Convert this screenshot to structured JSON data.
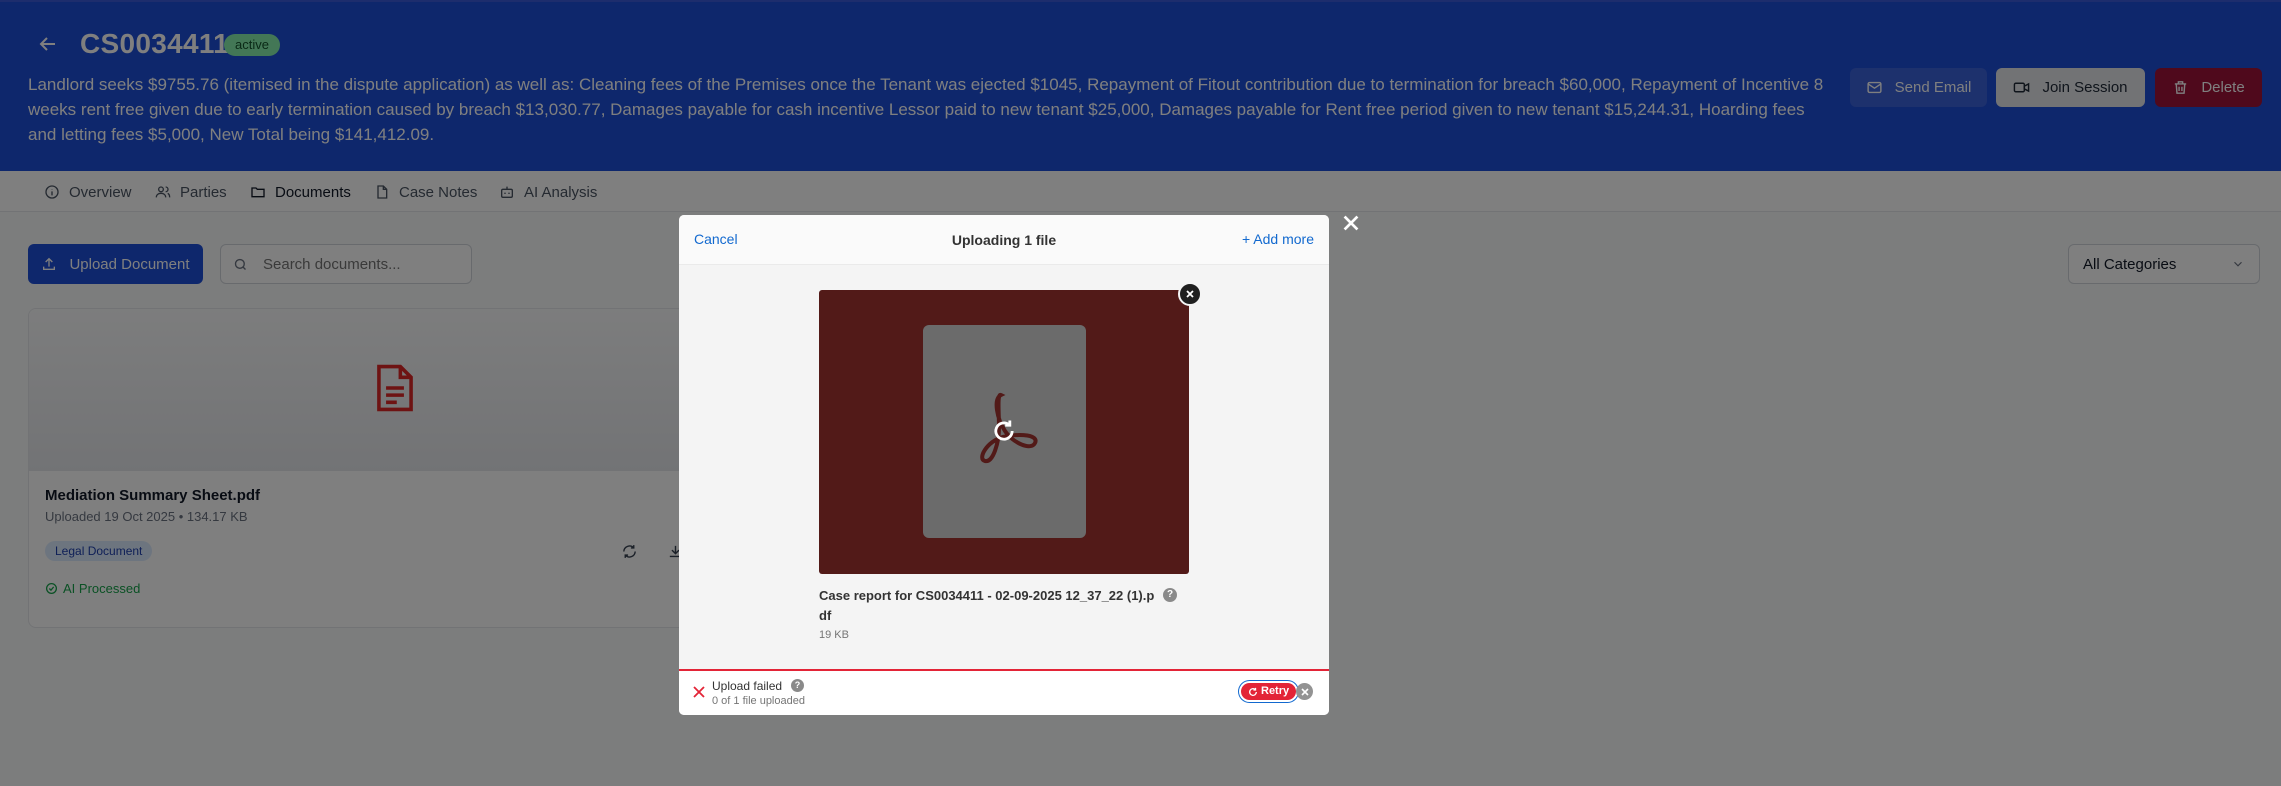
{
  "case": {
    "id": "CS0034411",
    "status": "active",
    "description": "Landlord seeks $9755.76 (itemised in the dispute application) as well as: Cleaning fees of the Premises once the Tenant was ejected $1045, Repayment of Fitout contribution due to termination for breach $60,000, Repayment of Incentive 8 weeks rent free given due to early termination caused by breach $13,030.77, Damages payable for cash incentive Lessor paid to new tenant $25,000, Damages payable for Rent free period given to new tenant $15,244.31, Hoarding fees and letting fees $5,000, New Total being $141,412.09."
  },
  "header_actions": {
    "send_email": "Send Email",
    "join_session": "Join Session",
    "delete": "Delete"
  },
  "tabs": [
    {
      "label": "Overview",
      "icon": "info-icon"
    },
    {
      "label": "Parties",
      "icon": "users-icon"
    },
    {
      "label": "Documents",
      "icon": "folder-icon"
    },
    {
      "label": "Case Notes",
      "icon": "file-icon"
    },
    {
      "label": "AI Analysis",
      "icon": "robot-icon"
    }
  ],
  "toolbar": {
    "upload_label": "Upload Document",
    "search_placeholder": "Search documents...",
    "category_selected": "All Categories"
  },
  "document": {
    "name": "Mediation Summary Sheet.pdf",
    "meta": "Uploaded 19 Oct 2025 • 134.17 KB",
    "category": "Legal Document",
    "ai_status": "AI Processed"
  },
  "modal": {
    "cancel": "Cancel",
    "title": "Uploading 1 file",
    "add_more": "Add more",
    "file_name": "Case report for CS0034411 - 02-09-2025 12_37_22 (1).pdf",
    "file_size": "19 KB",
    "status_title": "Upload failed",
    "status_sub": "0 of 1 file uploaded",
    "retry": "Retry",
    "help": "?"
  },
  "colors": {
    "header_bg": "#1d4ed8",
    "error_red": "#e32437",
    "link_blue": "#1269cf",
    "thumb_bg": "#521a18"
  }
}
